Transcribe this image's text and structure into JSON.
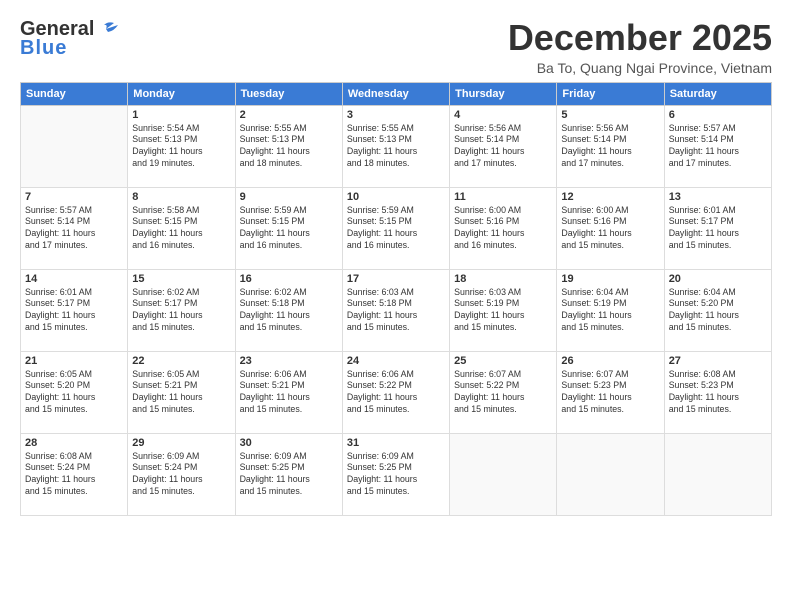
{
  "header": {
    "logo_general": "General",
    "logo_blue": "Blue",
    "month_title": "December 2025",
    "location": "Ba To, Quang Ngai Province, Vietnam"
  },
  "days_of_week": [
    "Sunday",
    "Monday",
    "Tuesday",
    "Wednesday",
    "Thursday",
    "Friday",
    "Saturday"
  ],
  "weeks": [
    [
      {
        "day": "",
        "info": ""
      },
      {
        "day": "1",
        "info": "Sunrise: 5:54 AM\nSunset: 5:13 PM\nDaylight: 11 hours\nand 19 minutes."
      },
      {
        "day": "2",
        "info": "Sunrise: 5:55 AM\nSunset: 5:13 PM\nDaylight: 11 hours\nand 18 minutes."
      },
      {
        "day": "3",
        "info": "Sunrise: 5:55 AM\nSunset: 5:13 PM\nDaylight: 11 hours\nand 18 minutes."
      },
      {
        "day": "4",
        "info": "Sunrise: 5:56 AM\nSunset: 5:14 PM\nDaylight: 11 hours\nand 17 minutes."
      },
      {
        "day": "5",
        "info": "Sunrise: 5:56 AM\nSunset: 5:14 PM\nDaylight: 11 hours\nand 17 minutes."
      },
      {
        "day": "6",
        "info": "Sunrise: 5:57 AM\nSunset: 5:14 PM\nDaylight: 11 hours\nand 17 minutes."
      }
    ],
    [
      {
        "day": "7",
        "info": "Sunrise: 5:57 AM\nSunset: 5:14 PM\nDaylight: 11 hours\nand 17 minutes."
      },
      {
        "day": "8",
        "info": "Sunrise: 5:58 AM\nSunset: 5:15 PM\nDaylight: 11 hours\nand 16 minutes."
      },
      {
        "day": "9",
        "info": "Sunrise: 5:59 AM\nSunset: 5:15 PM\nDaylight: 11 hours\nand 16 minutes."
      },
      {
        "day": "10",
        "info": "Sunrise: 5:59 AM\nSunset: 5:15 PM\nDaylight: 11 hours\nand 16 minutes."
      },
      {
        "day": "11",
        "info": "Sunrise: 6:00 AM\nSunset: 5:16 PM\nDaylight: 11 hours\nand 16 minutes."
      },
      {
        "day": "12",
        "info": "Sunrise: 6:00 AM\nSunset: 5:16 PM\nDaylight: 11 hours\nand 15 minutes."
      },
      {
        "day": "13",
        "info": "Sunrise: 6:01 AM\nSunset: 5:17 PM\nDaylight: 11 hours\nand 15 minutes."
      }
    ],
    [
      {
        "day": "14",
        "info": "Sunrise: 6:01 AM\nSunset: 5:17 PM\nDaylight: 11 hours\nand 15 minutes."
      },
      {
        "day": "15",
        "info": "Sunrise: 6:02 AM\nSunset: 5:17 PM\nDaylight: 11 hours\nand 15 minutes."
      },
      {
        "day": "16",
        "info": "Sunrise: 6:02 AM\nSunset: 5:18 PM\nDaylight: 11 hours\nand 15 minutes."
      },
      {
        "day": "17",
        "info": "Sunrise: 6:03 AM\nSunset: 5:18 PM\nDaylight: 11 hours\nand 15 minutes."
      },
      {
        "day": "18",
        "info": "Sunrise: 6:03 AM\nSunset: 5:19 PM\nDaylight: 11 hours\nand 15 minutes."
      },
      {
        "day": "19",
        "info": "Sunrise: 6:04 AM\nSunset: 5:19 PM\nDaylight: 11 hours\nand 15 minutes."
      },
      {
        "day": "20",
        "info": "Sunrise: 6:04 AM\nSunset: 5:20 PM\nDaylight: 11 hours\nand 15 minutes."
      }
    ],
    [
      {
        "day": "21",
        "info": "Sunrise: 6:05 AM\nSunset: 5:20 PM\nDaylight: 11 hours\nand 15 minutes."
      },
      {
        "day": "22",
        "info": "Sunrise: 6:05 AM\nSunset: 5:21 PM\nDaylight: 11 hours\nand 15 minutes."
      },
      {
        "day": "23",
        "info": "Sunrise: 6:06 AM\nSunset: 5:21 PM\nDaylight: 11 hours\nand 15 minutes."
      },
      {
        "day": "24",
        "info": "Sunrise: 6:06 AM\nSunset: 5:22 PM\nDaylight: 11 hours\nand 15 minutes."
      },
      {
        "day": "25",
        "info": "Sunrise: 6:07 AM\nSunset: 5:22 PM\nDaylight: 11 hours\nand 15 minutes."
      },
      {
        "day": "26",
        "info": "Sunrise: 6:07 AM\nSunset: 5:23 PM\nDaylight: 11 hours\nand 15 minutes."
      },
      {
        "day": "27",
        "info": "Sunrise: 6:08 AM\nSunset: 5:23 PM\nDaylight: 11 hours\nand 15 minutes."
      }
    ],
    [
      {
        "day": "28",
        "info": "Sunrise: 6:08 AM\nSunset: 5:24 PM\nDaylight: 11 hours\nand 15 minutes."
      },
      {
        "day": "29",
        "info": "Sunrise: 6:09 AM\nSunset: 5:24 PM\nDaylight: 11 hours\nand 15 minutes."
      },
      {
        "day": "30",
        "info": "Sunrise: 6:09 AM\nSunset: 5:25 PM\nDaylight: 11 hours\nand 15 minutes."
      },
      {
        "day": "31",
        "info": "Sunrise: 6:09 AM\nSunset: 5:25 PM\nDaylight: 11 hours\nand 15 minutes."
      },
      {
        "day": "",
        "info": ""
      },
      {
        "day": "",
        "info": ""
      },
      {
        "day": "",
        "info": ""
      }
    ]
  ]
}
